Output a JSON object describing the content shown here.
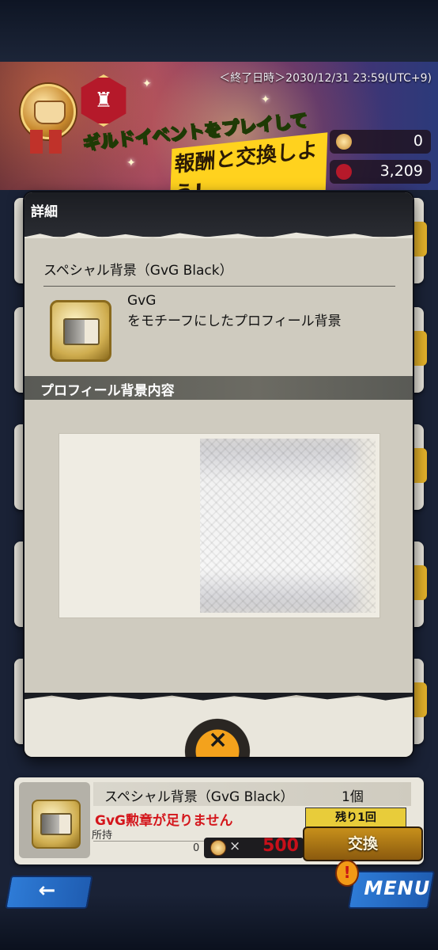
{
  "banner": {
    "end_date": "＜終了日時＞2030/12/31 23:59(UTC+9)",
    "title_line1": "ギルドイベントをプレイして",
    "title_line2": "報酬と交換しよう!",
    "currencies": [
      {
        "icon": "gvg-medal-icon",
        "value": "0"
      },
      {
        "icon": "castle-token-icon",
        "value": "3,209"
      }
    ]
  },
  "dialog": {
    "title": "詳細",
    "item_name": "スペシャル背景（GvG Black）",
    "item_desc_line1": "GvG",
    "item_desc_line2": "をモチーフにしたプロフィール背景",
    "section_title": "プロフィール背景内容",
    "close_icon": "×"
  },
  "exchange": {
    "item_name": "スペシャル背景（GvG Black）",
    "count": "1個",
    "warning": "GvG勲章が足りません",
    "owned_label": "所持",
    "owned_value": "0",
    "times": "×",
    "price": "500",
    "remaining": "残り1回",
    "button_label": "交換"
  },
  "nav": {
    "back_icon": "←",
    "menu_label": "MENU",
    "alert": "!"
  },
  "colors": {
    "warning": "#d4161c",
    "button_gold": "#c7901b",
    "nav_blue": "#2e7bd6"
  }
}
